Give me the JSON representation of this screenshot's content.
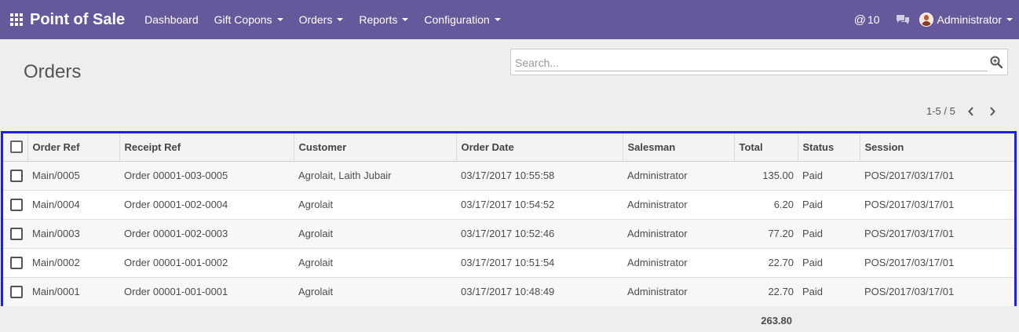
{
  "topbar": {
    "brand": "Point of Sale",
    "nav": [
      {
        "label": "Dashboard",
        "dropdown": false
      },
      {
        "label": "Gift Copons",
        "dropdown": true
      },
      {
        "label": "Orders",
        "dropdown": true
      },
      {
        "label": "Reports",
        "dropdown": true
      },
      {
        "label": "Configuration",
        "dropdown": true
      }
    ],
    "mentions": "10",
    "user": "Administrator",
    "accent_color": "#65599b"
  },
  "page": {
    "title": "Orders"
  },
  "search": {
    "placeholder": "Search..."
  },
  "pager": {
    "value": "1-5 / 5"
  },
  "table": {
    "columns": [
      "Order Ref",
      "Receipt Ref",
      "Customer",
      "Order Date",
      "Salesman",
      "Total",
      "Status",
      "Session"
    ],
    "rows": [
      [
        "Main/0005",
        "Order 00001-003-0005",
        "Agrolait, Laith Jubair",
        "03/17/2017 10:55:58",
        "Administrator",
        "135.00",
        "Paid",
        "POS/2017/03/17/01"
      ],
      [
        "Main/0004",
        "Order 00001-002-0004",
        "Agrolait",
        "03/17/2017 10:54:52",
        "Administrator",
        "6.20",
        "Paid",
        "POS/2017/03/17/01"
      ],
      [
        "Main/0003",
        "Order 00001-002-0003",
        "Agrolait",
        "03/17/2017 10:52:46",
        "Administrator",
        "77.20",
        "Paid",
        "POS/2017/03/17/01"
      ],
      [
        "Main/0002",
        "Order 00001-001-0002",
        "Agrolait",
        "03/17/2017 10:51:54",
        "Administrator",
        "22.70",
        "Paid",
        "POS/2017/03/17/01"
      ],
      [
        "Main/0001",
        "Order 00001-001-0001",
        "Agrolait",
        "03/17/2017 10:48:49",
        "Administrator",
        "22.70",
        "Paid",
        "POS/2017/03/17/01"
      ]
    ],
    "total_sum": "263.80"
  }
}
